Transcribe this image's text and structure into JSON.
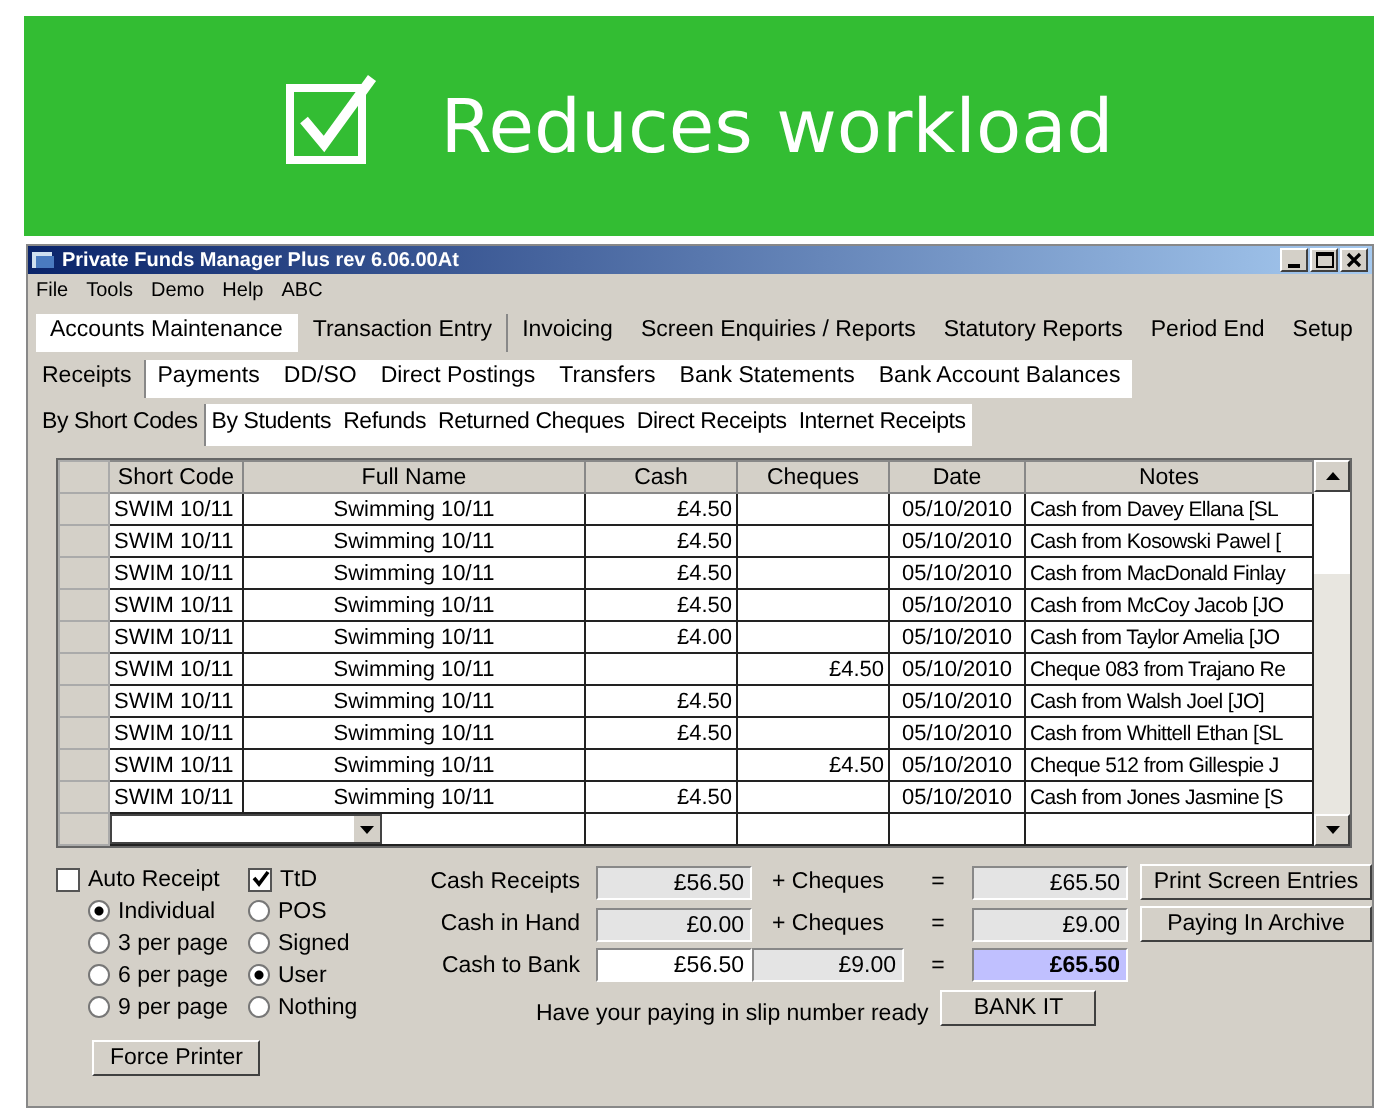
{
  "banner": {
    "text": "Reduces workload"
  },
  "window": {
    "title": "Private Funds Manager Plus rev 6.06.00At"
  },
  "menu": [
    "File",
    "Tools",
    "Demo",
    "Help",
    "ABC"
  ],
  "main_tabs": [
    {
      "label": "Accounts Maintenance",
      "selected": false
    },
    {
      "label": "Transaction Entry",
      "selected": true
    },
    {
      "label": "Invoicing",
      "selected": false
    },
    {
      "label": "Screen Enquiries / Reports",
      "selected": false
    },
    {
      "label": "Statutory Reports",
      "selected": false
    },
    {
      "label": "Period End",
      "selected": false
    },
    {
      "label": "Setup",
      "selected": false
    }
  ],
  "sub_tabs": [
    {
      "label": "Receipts",
      "selected": true
    },
    {
      "label": "Payments",
      "selected": false
    },
    {
      "label": "DD/SO",
      "selected": false
    },
    {
      "label": "Direct Postings",
      "selected": false
    },
    {
      "label": "Transfers",
      "selected": false
    },
    {
      "label": "Bank Statements",
      "selected": false
    },
    {
      "label": "Bank Account Balances",
      "selected": false
    }
  ],
  "view_tabs": [
    {
      "label": "By Short Codes",
      "selected": true
    },
    {
      "label": "By Students",
      "selected": false
    },
    {
      "label": "Refunds",
      "selected": false
    },
    {
      "label": "Returned Cheques",
      "selected": false
    },
    {
      "label": "Direct Receipts",
      "selected": false
    },
    {
      "label": "Internet Receipts",
      "selected": false
    }
  ],
  "table": {
    "columns": [
      "Short Code",
      "Full Name",
      "Cash",
      "Cheques",
      "Date",
      "Notes"
    ],
    "rows": [
      {
        "cells": [
          "SWIM 10/11",
          "Swimming 10/11",
          "£4.50",
          "",
          "05/10/2010",
          "Cash from Davey Ellana [SL"
        ]
      },
      {
        "cells": [
          "SWIM 10/11",
          "Swimming 10/11",
          "£4.50",
          "",
          "05/10/2010",
          "Cash from Kosowski Pawel ["
        ]
      },
      {
        "cells": [
          "SWIM 10/11",
          "Swimming 10/11",
          "£4.50",
          "",
          "05/10/2010",
          "Cash from MacDonald Finlay"
        ]
      },
      {
        "cells": [
          "SWIM 10/11",
          "Swimming 10/11",
          "£4.50",
          "",
          "05/10/2010",
          "Cash from McCoy Jacob [JO"
        ]
      },
      {
        "cells": [
          "SWIM 10/11",
          "Swimming 10/11",
          "£4.00",
          "",
          "05/10/2010",
          "Cash from Taylor Amelia [JO"
        ]
      },
      {
        "cells": [
          "SWIM 10/11",
          "Swimming 10/11",
          "",
          "£4.50",
          "05/10/2010",
          "Cheque 083 from Trajano Re"
        ]
      },
      {
        "cells": [
          "SWIM 10/11",
          "Swimming 10/11",
          "£4.50",
          "",
          "05/10/2010",
          "Cash from Walsh Joel [JO]"
        ]
      },
      {
        "cells": [
          "SWIM 10/11",
          "Swimming 10/11",
          "£4.50",
          "",
          "05/10/2010",
          "Cash from Whittell Ethan [SL"
        ]
      },
      {
        "cells": [
          "SWIM 10/11",
          "Swimming 10/11",
          "",
          "£4.50",
          "05/10/2010",
          "Cheque 512 from Gillespie J"
        ]
      },
      {
        "cells": [
          "SWIM 10/11",
          "Swimming 10/11",
          "£4.50",
          "",
          "05/10/2010",
          "Cash from Jones Jasmine [S"
        ]
      }
    ]
  },
  "options": {
    "auto_receipt": {
      "label": "Auto Receipt",
      "checked": false
    },
    "ttd": {
      "label": "TtD",
      "checked": true
    },
    "copies": [
      {
        "label": "Individual",
        "selected": true
      },
      {
        "label": "3 per page",
        "selected": false
      },
      {
        "label": "6 per page",
        "selected": false
      },
      {
        "label": "9 per page",
        "selected": false
      }
    ],
    "signature": [
      {
        "label": "POS",
        "selected": false
      },
      {
        "label": "Signed",
        "selected": false
      },
      {
        "label": "User",
        "selected": true
      },
      {
        "label": "Nothing",
        "selected": false
      }
    ]
  },
  "totals": [
    {
      "kind": "summary",
      "label": "Cash Receipts",
      "cash": "£56.50",
      "cheques_label": "+ Cheques",
      "equals": "=",
      "total": "£65.50"
    },
    {
      "kind": "summary",
      "label": "Cash in Hand",
      "cash": "£0.00",
      "cheques_label": "+ Cheques",
      "equals": "=",
      "total": "£9.00"
    },
    {
      "kind": "bank",
      "label": "Cash to Bank",
      "cash": "£56.50",
      "cheques": "£9.00",
      "equals": "=",
      "total": "£65.50"
    }
  ],
  "side_buttons": [
    "Print Screen Entries",
    "Paying In Archive"
  ],
  "force_button": "Force Printer",
  "hint": "Have your paying in slip number ready",
  "bank_button": "BANK IT"
}
